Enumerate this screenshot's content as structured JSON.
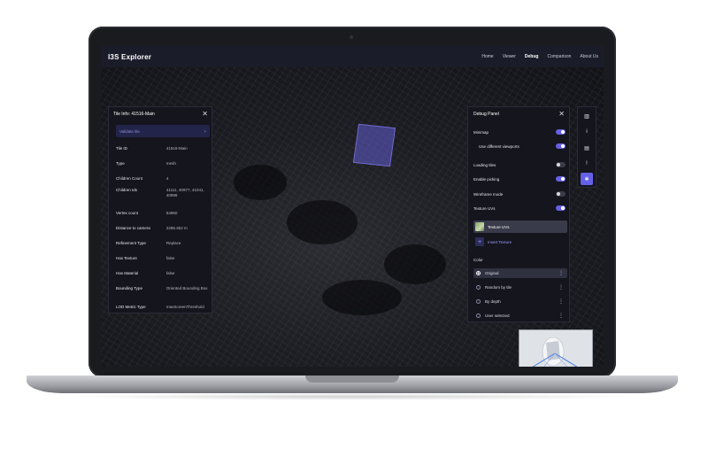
{
  "header": {
    "title": "I3S Explorer",
    "nav": [
      "Home",
      "Viewer",
      "Debug",
      "Comparison",
      "About Us"
    ],
    "active_nav": "Debug"
  },
  "tile_info": {
    "title": "Tile Info: 41516-Main",
    "validate_label": "Validate tile",
    "validate_chevron": ">",
    "close": "✕",
    "rows": [
      {
        "key": "Tile ID",
        "value": "41516-Main"
      },
      {
        "key": "Type",
        "value": "mesh"
      },
      {
        "key": "Children Count",
        "value": "4"
      },
      {
        "key": "Children Ids",
        "value": "41111, 40977, 41041, 40998"
      },
      {
        "key": "Vertex count",
        "value": "64960"
      },
      {
        "key": "Distance to camera",
        "value": "2286.362 m"
      },
      {
        "key": "Refinement Type",
        "value": "Replace"
      },
      {
        "key": "Has Texture",
        "value": "false"
      },
      {
        "key": "Has Material",
        "value": "false"
      },
      {
        "key": "Bounding Type",
        "value": "Oriented Bounding Box"
      },
      {
        "key": "LOD Metric Type",
        "value": "maxScreenThreshold"
      }
    ]
  },
  "debug_panel": {
    "title": "Debug Panel",
    "close": "✕",
    "options": [
      {
        "label": "Minimap",
        "on": true
      },
      {
        "label": "Use different viewports",
        "on": true
      },
      {
        "label": "Loading tiles",
        "on": false
      },
      {
        "label": "Enable picking",
        "on": true
      },
      {
        "label": "Wireframe mode",
        "on": false
      },
      {
        "label": "Texture UVs",
        "on": true
      }
    ],
    "texture_items": [
      "Texture UVs",
      "Insert Texture"
    ],
    "color_label": "Color",
    "color_options": [
      {
        "label": "Original",
        "selected": true
      },
      {
        "label": "Random by tile",
        "selected": false
      },
      {
        "label": "By depth",
        "selected": false
      },
      {
        "label": "User selected",
        "selected": false
      }
    ]
  },
  "side_toolbar": {
    "icons": [
      "map-icon",
      "info-icon",
      "memory-icon",
      "alert-icon",
      "debug-icon"
    ],
    "glyphs": [
      "▥",
      "i",
      "▤",
      "!",
      "✱"
    ],
    "active_index": 4
  },
  "colors": {
    "accent": "#6561e6",
    "panel_bg": "#14151d",
    "header_bg": "#1b1c2a",
    "selection": "#625cd2"
  }
}
